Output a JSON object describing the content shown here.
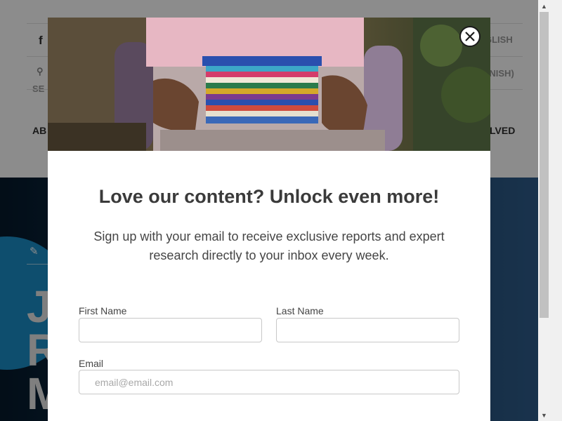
{
  "background": {
    "header": {
      "social_icon": "f",
      "search_label": "SE",
      "lang_english": "GLISH",
      "lang_spanish": "ANISH)",
      "nav_left": "AB",
      "nav_right": "LVED"
    },
    "hero": {
      "edit_icon": "pencil-icon",
      "letters": [
        "J",
        "R",
        "M"
      ]
    }
  },
  "modal": {
    "headline": "Love our content? Unlock even more!",
    "subtext": "Sign up with your email to receive exclusive reports and expert research directly to your inbox every week.",
    "form": {
      "first_name_label": "First Name",
      "first_name_value": "",
      "last_name_label": "Last Name",
      "last_name_value": "",
      "email_label": "Email",
      "email_placeholder": "email@email.com",
      "email_value": ""
    },
    "close_icon": "close-icon"
  },
  "colors": {
    "overlay": "#00000073",
    "hero_dark": "#061a2c",
    "hero_circle": "#1a8ec8",
    "text_dark": "#3a3a3a"
  }
}
